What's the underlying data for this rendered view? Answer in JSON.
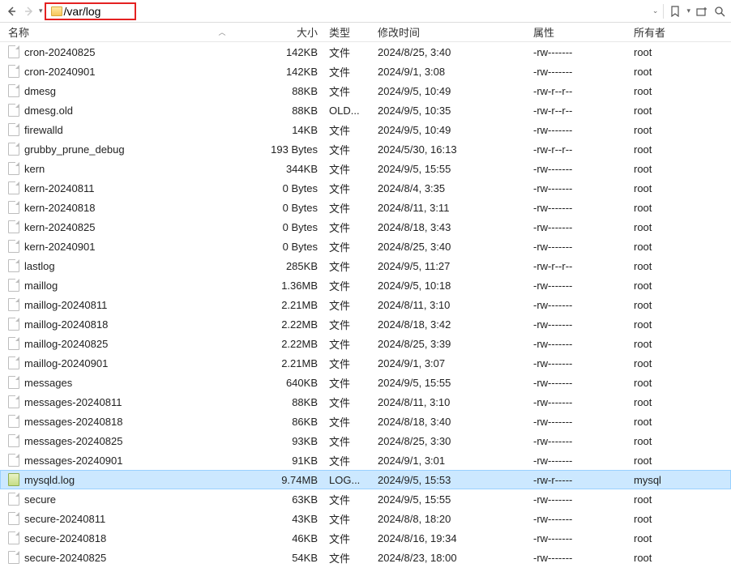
{
  "toolbar": {
    "path": "/var/log"
  },
  "headers": {
    "name": "名称",
    "size": "大小",
    "type": "类型",
    "date": "修改时间",
    "attr": "属性",
    "owner": "所有者"
  },
  "files": [
    {
      "name": "cron-20240825",
      "size": "142KB",
      "type": "文件",
      "date": "2024/8/25, 3:40",
      "attr": "-rw-------",
      "owner": "root",
      "icon": "generic",
      "selected": false
    },
    {
      "name": "cron-20240901",
      "size": "142KB",
      "type": "文件",
      "date": "2024/9/1, 3:08",
      "attr": "-rw-------",
      "owner": "root",
      "icon": "generic",
      "selected": false
    },
    {
      "name": "dmesg",
      "size": "88KB",
      "type": "文件",
      "date": "2024/9/5, 10:49",
      "attr": "-rw-r--r--",
      "owner": "root",
      "icon": "generic",
      "selected": false
    },
    {
      "name": "dmesg.old",
      "size": "88KB",
      "type": "OLD...",
      "date": "2024/9/5, 10:35",
      "attr": "-rw-r--r--",
      "owner": "root",
      "icon": "generic",
      "selected": false
    },
    {
      "name": "firewalld",
      "size": "14KB",
      "type": "文件",
      "date": "2024/9/5, 10:49",
      "attr": "-rw-------",
      "owner": "root",
      "icon": "generic",
      "selected": false
    },
    {
      "name": "grubby_prune_debug",
      "size": "193 Bytes",
      "type": "文件",
      "date": "2024/5/30, 16:13",
      "attr": "-rw-r--r--",
      "owner": "root",
      "icon": "generic",
      "selected": false
    },
    {
      "name": "kern",
      "size": "344KB",
      "type": "文件",
      "date": "2024/9/5, 15:55",
      "attr": "-rw-------",
      "owner": "root",
      "icon": "generic",
      "selected": false
    },
    {
      "name": "kern-20240811",
      "size": "0 Bytes",
      "type": "文件",
      "date": "2024/8/4, 3:35",
      "attr": "-rw-------",
      "owner": "root",
      "icon": "generic",
      "selected": false
    },
    {
      "name": "kern-20240818",
      "size": "0 Bytes",
      "type": "文件",
      "date": "2024/8/11, 3:11",
      "attr": "-rw-------",
      "owner": "root",
      "icon": "generic",
      "selected": false
    },
    {
      "name": "kern-20240825",
      "size": "0 Bytes",
      "type": "文件",
      "date": "2024/8/18, 3:43",
      "attr": "-rw-------",
      "owner": "root",
      "icon": "generic",
      "selected": false
    },
    {
      "name": "kern-20240901",
      "size": "0 Bytes",
      "type": "文件",
      "date": "2024/8/25, 3:40",
      "attr": "-rw-------",
      "owner": "root",
      "icon": "generic",
      "selected": false
    },
    {
      "name": "lastlog",
      "size": "285KB",
      "type": "文件",
      "date": "2024/9/5, 11:27",
      "attr": "-rw-r--r--",
      "owner": "root",
      "icon": "generic",
      "selected": false
    },
    {
      "name": "maillog",
      "size": "1.36MB",
      "type": "文件",
      "date": "2024/9/5, 10:18",
      "attr": "-rw-------",
      "owner": "root",
      "icon": "generic",
      "selected": false
    },
    {
      "name": "maillog-20240811",
      "size": "2.21MB",
      "type": "文件",
      "date": "2024/8/11, 3:10",
      "attr": "-rw-------",
      "owner": "root",
      "icon": "generic",
      "selected": false
    },
    {
      "name": "maillog-20240818",
      "size": "2.22MB",
      "type": "文件",
      "date": "2024/8/18, 3:42",
      "attr": "-rw-------",
      "owner": "root",
      "icon": "generic",
      "selected": false
    },
    {
      "name": "maillog-20240825",
      "size": "2.22MB",
      "type": "文件",
      "date": "2024/8/25, 3:39",
      "attr": "-rw-------",
      "owner": "root",
      "icon": "generic",
      "selected": false
    },
    {
      "name": "maillog-20240901",
      "size": "2.21MB",
      "type": "文件",
      "date": "2024/9/1, 3:07",
      "attr": "-rw-------",
      "owner": "root",
      "icon": "generic",
      "selected": false
    },
    {
      "name": "messages",
      "size": "640KB",
      "type": "文件",
      "date": "2024/9/5, 15:55",
      "attr": "-rw-------",
      "owner": "root",
      "icon": "generic",
      "selected": false
    },
    {
      "name": "messages-20240811",
      "size": "88KB",
      "type": "文件",
      "date": "2024/8/11, 3:10",
      "attr": "-rw-------",
      "owner": "root",
      "icon": "generic",
      "selected": false
    },
    {
      "name": "messages-20240818",
      "size": "86KB",
      "type": "文件",
      "date": "2024/8/18, 3:40",
      "attr": "-rw-------",
      "owner": "root",
      "icon": "generic",
      "selected": false
    },
    {
      "name": "messages-20240825",
      "size": "93KB",
      "type": "文件",
      "date": "2024/8/25, 3:30",
      "attr": "-rw-------",
      "owner": "root",
      "icon": "generic",
      "selected": false
    },
    {
      "name": "messages-20240901",
      "size": "91KB",
      "type": "文件",
      "date": "2024/9/1, 3:01",
      "attr": "-rw-------",
      "owner": "root",
      "icon": "generic",
      "selected": false
    },
    {
      "name": "mysqld.log",
      "size": "9.74MB",
      "type": "LOG...",
      "date": "2024/9/5, 15:53",
      "attr": "-rw-r-----",
      "owner": "mysql",
      "icon": "log",
      "selected": true
    },
    {
      "name": "secure",
      "size": "63KB",
      "type": "文件",
      "date": "2024/9/5, 15:55",
      "attr": "-rw-------",
      "owner": "root",
      "icon": "generic",
      "selected": false
    },
    {
      "name": "secure-20240811",
      "size": "43KB",
      "type": "文件",
      "date": "2024/8/8, 18:20",
      "attr": "-rw-------",
      "owner": "root",
      "icon": "generic",
      "selected": false
    },
    {
      "name": "secure-20240818",
      "size": "46KB",
      "type": "文件",
      "date": "2024/8/16, 19:34",
      "attr": "-rw-------",
      "owner": "root",
      "icon": "generic",
      "selected": false
    },
    {
      "name": "secure-20240825",
      "size": "54KB",
      "type": "文件",
      "date": "2024/8/23, 18:00",
      "attr": "-rw-------",
      "owner": "root",
      "icon": "generic",
      "selected": false
    }
  ]
}
